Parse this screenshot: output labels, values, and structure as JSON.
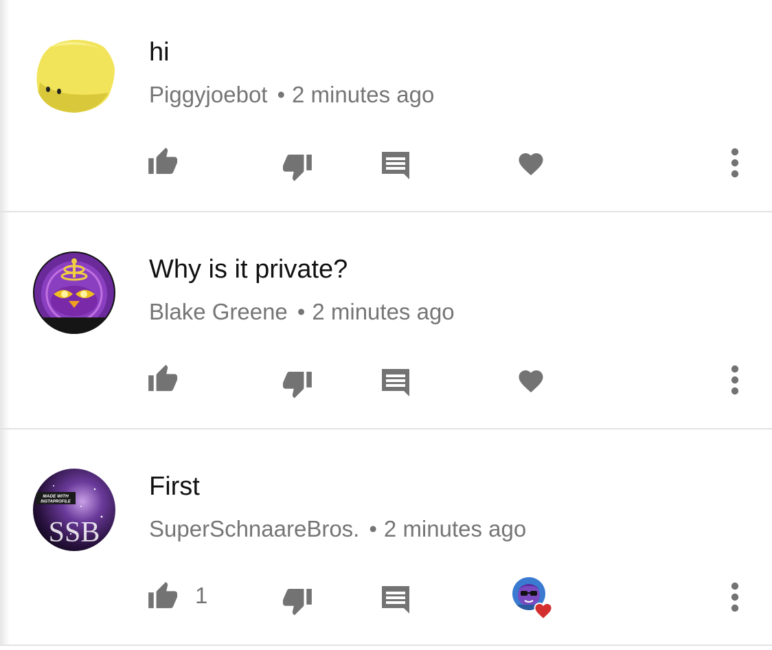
{
  "colors": {
    "text_primary": "#111111",
    "text_secondary": "#757575",
    "icon": "#737373",
    "divider": "#e2e2e2",
    "heart_red": "#d32f2f"
  },
  "comments": [
    {
      "text": "hi",
      "author": "Piggyjoebot",
      "separator": "•",
      "time": "2 minutes ago",
      "like_count": "",
      "hearted_by_creator": false,
      "avatar_icon": "yellow-head-avatar"
    },
    {
      "text": "Why is it private?",
      "author": "Blake Greene",
      "separator": "•",
      "time": "2 minutes ago",
      "like_count": "",
      "hearted_by_creator": false,
      "avatar_icon": "purple-character-avatar"
    },
    {
      "text": "First",
      "author": "SuperSchnaareBros.",
      "separator": "•",
      "time": "2 minutes ago",
      "like_count": "1",
      "hearted_by_creator": true,
      "avatar_icon": "galaxy-ssb-avatar",
      "avatar_text": {
        "line1": "MADE WITH",
        "line2": "INSTAPROFILE",
        "logo": "SSB"
      }
    }
  ],
  "icons": {
    "like": "thumbs-up-icon",
    "dislike": "thumbs-down-icon",
    "reply": "reply-icon",
    "heart": "heart-icon",
    "more": "more-vert-icon"
  }
}
